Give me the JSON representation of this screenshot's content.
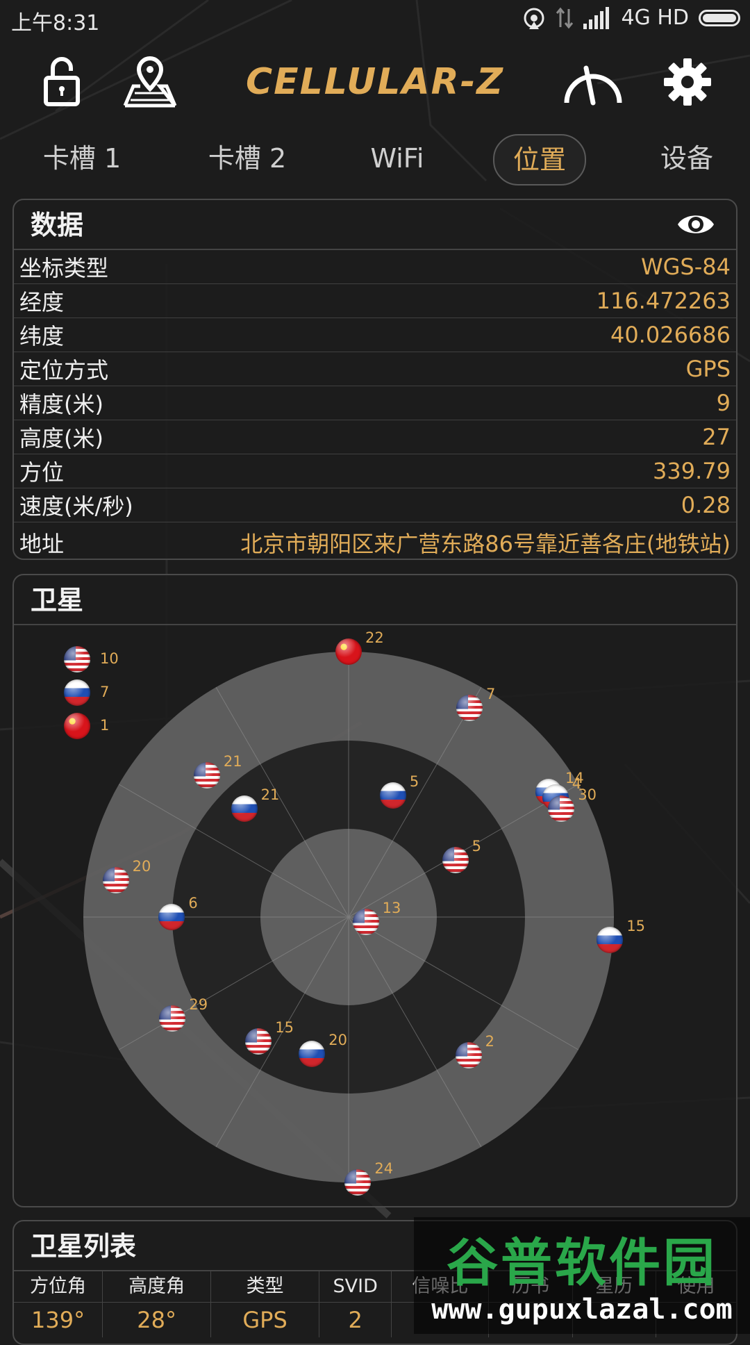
{
  "status_bar": {
    "time": "上午8:31",
    "network": "4G HD"
  },
  "top_bar": {
    "logo_text": "CELLULAR-Z",
    "icons": [
      "unlock-icon",
      "map-pin-icon",
      "speedometer-icon",
      "gear-icon"
    ]
  },
  "tabs": [
    {
      "label": "卡槽 1",
      "active": false
    },
    {
      "label": "卡槽 2",
      "active": false
    },
    {
      "label": "WiFi",
      "active": false
    },
    {
      "label": "位置",
      "active": true
    },
    {
      "label": "设备",
      "active": false
    }
  ],
  "data_card": {
    "title": "数据",
    "rows": [
      {
        "label": "坐标类型",
        "value": "WGS-84"
      },
      {
        "label": "经度",
        "value": "116.472263"
      },
      {
        "label": "纬度",
        "value": "40.026686"
      },
      {
        "label": "定位方式",
        "value": "GPS"
      },
      {
        "label": "精度(米)",
        "value": "9"
      },
      {
        "label": "高度(米)",
        "value": "27"
      },
      {
        "label": "方位",
        "value": "339.79"
      },
      {
        "label": "速度(米/秒)",
        "value": "0.28"
      },
      {
        "label": "地址",
        "value": "北京市朝阳区来广营东路86号靠近善各庄(地铁站)"
      }
    ]
  },
  "satellite_card": {
    "title": "卫星",
    "legend": [
      {
        "flag": "us",
        "count": "10"
      },
      {
        "flag": "ru",
        "count": "7"
      },
      {
        "flag": "cn",
        "count": "1"
      }
    ],
    "satellites": [
      {
        "flag": "cn",
        "id": "22",
        "azimuth": 0,
        "elevation": 0
      },
      {
        "flag": "us",
        "id": "7",
        "azimuth": 30,
        "elevation": 8
      },
      {
        "flag": "ru",
        "id": "14",
        "azimuth": 58,
        "elevation": 10
      },
      {
        "flag": "ru",
        "id": "4",
        "azimuth": 60,
        "elevation": 9
      },
      {
        "flag": "us",
        "id": "30",
        "azimuth": 63,
        "elevation": 9
      },
      {
        "flag": "us",
        "id": "21",
        "azimuth": 315,
        "elevation": 22
      },
      {
        "flag": "ru",
        "id": "21",
        "azimuth": 316,
        "elevation": 39
      },
      {
        "flag": "ru",
        "id": "5",
        "azimuth": 20,
        "elevation": 46
      },
      {
        "flag": "us",
        "id": "5",
        "azimuth": 62,
        "elevation": 49
      },
      {
        "flag": "us",
        "id": "20",
        "azimuth": 279,
        "elevation": 10
      },
      {
        "flag": "ru",
        "id": "6",
        "azimuth": 270,
        "elevation": 30
      },
      {
        "flag": "us",
        "id": "13",
        "azimuth": 105,
        "elevation": 84
      },
      {
        "flag": "ru",
        "id": "15",
        "azimuth": 95,
        "elevation": 1
      },
      {
        "flag": "us",
        "id": "29",
        "azimuth": 240,
        "elevation": 21
      },
      {
        "flag": "us",
        "id": "15",
        "azimuth": 216,
        "elevation": 38
      },
      {
        "flag": "ru",
        "id": "20",
        "azimuth": 195,
        "elevation": 42
      },
      {
        "flag": "us",
        "id": "2",
        "azimuth": 139,
        "elevation": 28
      },
      {
        "flag": "us",
        "id": "24",
        "azimuth": 178,
        "elevation": 0
      }
    ]
  },
  "satellite_list": {
    "title": "卫星列表",
    "columns": [
      "方位角",
      "高度角",
      "类型",
      "SVID",
      "信噪比",
      "历书",
      "星历",
      "使用"
    ],
    "first_row": [
      "139°",
      "28°",
      "GPS",
      "2",
      "",
      "",
      "",
      ""
    ]
  },
  "watermark": {
    "title": "谷普软件园",
    "url": "www.gupuxlazal.com"
  },
  "colors": {
    "accent": "#e1ac58",
    "background": "#1c1c1c",
    "ring": "#707070"
  }
}
